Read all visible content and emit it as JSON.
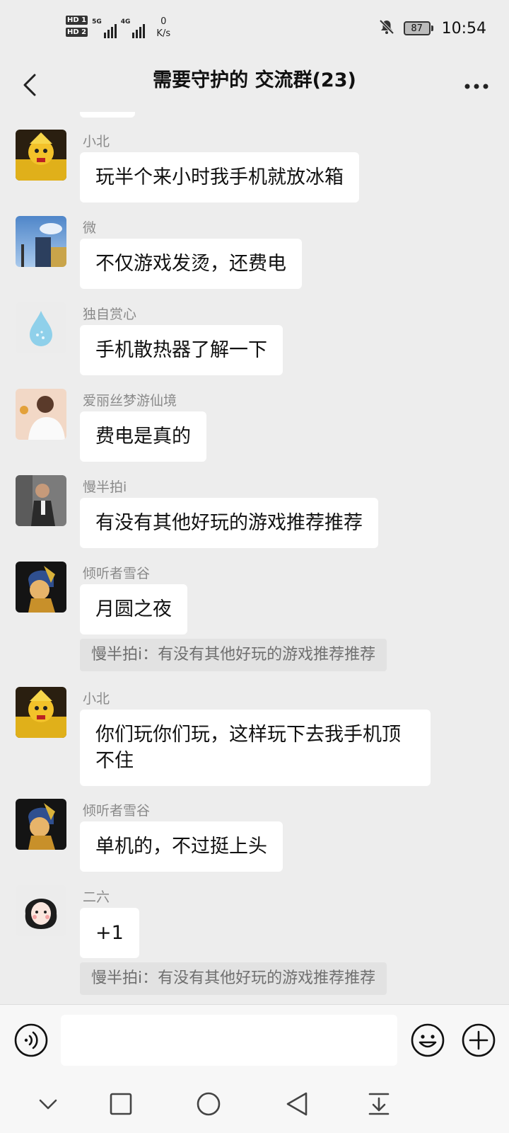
{
  "status_bar": {
    "hd1": "HD 1",
    "hd2": "HD 2",
    "sim1_network": "5G",
    "sim2_network": "4G",
    "net_speed_value": "0",
    "net_speed_unit": "K/s",
    "battery_percent": "87",
    "time": "10:54",
    "icons": [
      "bell-muted-icon",
      "battery-icon"
    ]
  },
  "header": {
    "title": "需要守护的 交流群(23)",
    "back_icon": "chevron-left-icon",
    "more_icon": "more-dots-icon"
  },
  "messages": [
    {
      "sender": "小北",
      "text": "玩半个来小时我手机就放冰箱",
      "avatar": "cartoon-warrior"
    },
    {
      "sender": "微",
      "text": "不仅游戏发烫，还费电",
      "avatar": "sky-building"
    },
    {
      "sender": "独自赏心",
      "text": "手机散热器了解一下",
      "avatar": "water-drop"
    },
    {
      "sender": "爱丽丝梦游仙境",
      "text": "费电是真的",
      "avatar": "illustrated-person"
    },
    {
      "sender": "慢半拍i",
      "text": "有没有其他好玩的游戏推荐推荐",
      "avatar": "photo-man"
    },
    {
      "sender": "倾听者雪谷",
      "text": "月圆之夜",
      "avatar": "pearl-earring-cat",
      "quote": "慢半拍i：有没有其他好玩的游戏推荐推荐"
    },
    {
      "sender": "小北",
      "text": "你们玩你们玩，这样玩下去我手机顶不住",
      "avatar": "cartoon-warrior"
    },
    {
      "sender": "倾听者雪谷",
      "text": "单机的，不过挺上头",
      "avatar": "pearl-earring-cat"
    },
    {
      "sender": "二六",
      "text": "+1",
      "avatar": "anime-girl",
      "quote": "慢半拍i：有没有其他好玩的游戏推荐推荐"
    }
  ],
  "input_bar": {
    "value": "",
    "voice_icon": "voice-icon",
    "emoji_icon": "emoji-icon",
    "plus_icon": "plus-circle-icon"
  },
  "system_nav": {
    "icons": [
      "chevron-down-icon",
      "square-recent-icon",
      "circle-home-icon",
      "triangle-back-icon",
      "download-tray-icon"
    ]
  },
  "colors": {
    "background": "#ededed",
    "bubble": "#ffffff",
    "sender_text": "#8a8a8a",
    "quote_bg": "#e2e2e2"
  }
}
